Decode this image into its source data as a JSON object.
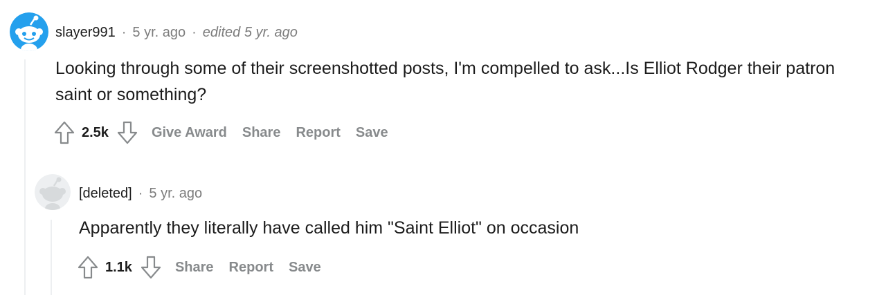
{
  "comments": [
    {
      "username": "slayer991",
      "separator": "·",
      "time": "5 yr. ago",
      "edited": "edited 5 yr. ago",
      "body": "Looking through some of their screenshotted posts, I'm compelled to ask...Is Elliot Rodger their patron saint or something?",
      "score": "2.5k",
      "actions": [
        "Give Award",
        "Share",
        "Report",
        "Save"
      ]
    },
    {
      "username": "[deleted]",
      "separator": "·",
      "time": "5 yr. ago",
      "body": "Apparently they literally have called him \"Saint Elliot\" on occasion",
      "score": "1.1k",
      "actions": [
        "Share",
        "Report",
        "Save"
      ]
    }
  ],
  "colors": {
    "avatar_blue": "#24a0ed",
    "deleted_avatar": "#d7dadc",
    "action_gray": "#878a8c",
    "meta_gray": "#7c7c7c",
    "thread_line": "#edeff1"
  },
  "icons": [
    "snoo-avatar-icon",
    "deleted-avatar-icon",
    "upvote-icon",
    "downvote-icon"
  ]
}
